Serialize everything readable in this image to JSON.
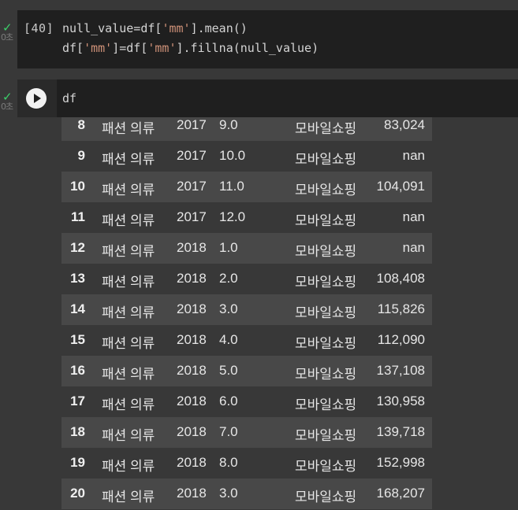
{
  "cell1": {
    "status_icon": "check-icon",
    "exec_time": "0초",
    "exec_count": "[40]",
    "code": {
      "l1_a": "null_value=df[",
      "l1_b": "'mm'",
      "l1_c": "].mean()",
      "l2_a": "df[",
      "l2_b": "'mm'",
      "l2_c": "]=df[",
      "l2_d": "'mm'",
      "l2_e": "].fillna(null_value)"
    }
  },
  "cell2": {
    "status_icon": "check-icon",
    "exec_time": "0초",
    "run_icon": "play-icon",
    "code": "df"
  },
  "table": {
    "rows": [
      {
        "idx": "8",
        "cat": "패션 의류",
        "year": "2017",
        "mm": "9.0",
        "channel": "모바일쇼핑",
        "value": "83,024"
      },
      {
        "idx": "9",
        "cat": "패션 의류",
        "year": "2017",
        "mm": "10.0",
        "channel": "모바일쇼핑",
        "value": "nan"
      },
      {
        "idx": "10",
        "cat": "패션 의류",
        "year": "2017",
        "mm": "11.0",
        "channel": "모바일쇼핑",
        "value": "104,091"
      },
      {
        "idx": "11",
        "cat": "패션 의류",
        "year": "2017",
        "mm": "12.0",
        "channel": "모바일쇼핑",
        "value": "nan"
      },
      {
        "idx": "12",
        "cat": "패션 의류",
        "year": "2018",
        "mm": "1.0",
        "channel": "모바일쇼핑",
        "value": "nan"
      },
      {
        "idx": "13",
        "cat": "패션 의류",
        "year": "2018",
        "mm": "2.0",
        "channel": "모바일쇼핑",
        "value": "108,408"
      },
      {
        "idx": "14",
        "cat": "패션 의류",
        "year": "2018",
        "mm": "3.0",
        "channel": "모바일쇼핑",
        "value": "115,826"
      },
      {
        "idx": "15",
        "cat": "패션 의류",
        "year": "2018",
        "mm": "4.0",
        "channel": "모바일쇼핑",
        "value": "112,090"
      },
      {
        "idx": "16",
        "cat": "패션 의류",
        "year": "2018",
        "mm": "5.0",
        "channel": "모바일쇼핑",
        "value": "137,108"
      },
      {
        "idx": "17",
        "cat": "패션 의류",
        "year": "2018",
        "mm": "6.0",
        "channel": "모바일쇼핑",
        "value": "130,958"
      },
      {
        "idx": "18",
        "cat": "패션 의류",
        "year": "2018",
        "mm": "7.0",
        "channel": "모바일쇼핑",
        "value": "139,718"
      },
      {
        "idx": "19",
        "cat": "패션 의류",
        "year": "2018",
        "mm": "8.0",
        "channel": "모바일쇼핑",
        "value": "152,998"
      },
      {
        "idx": "20",
        "cat": "패션 의류",
        "year": "2018",
        "mm": "3.0",
        "channel": "모바일쇼핑",
        "value": "168,207"
      }
    ]
  },
  "colors": {
    "cell_background": "#1f1f1f",
    "page_background": "#383838",
    "stripe": "#484848",
    "string_literal": "#ce9178",
    "status_ok": "#3ccf6a"
  }
}
